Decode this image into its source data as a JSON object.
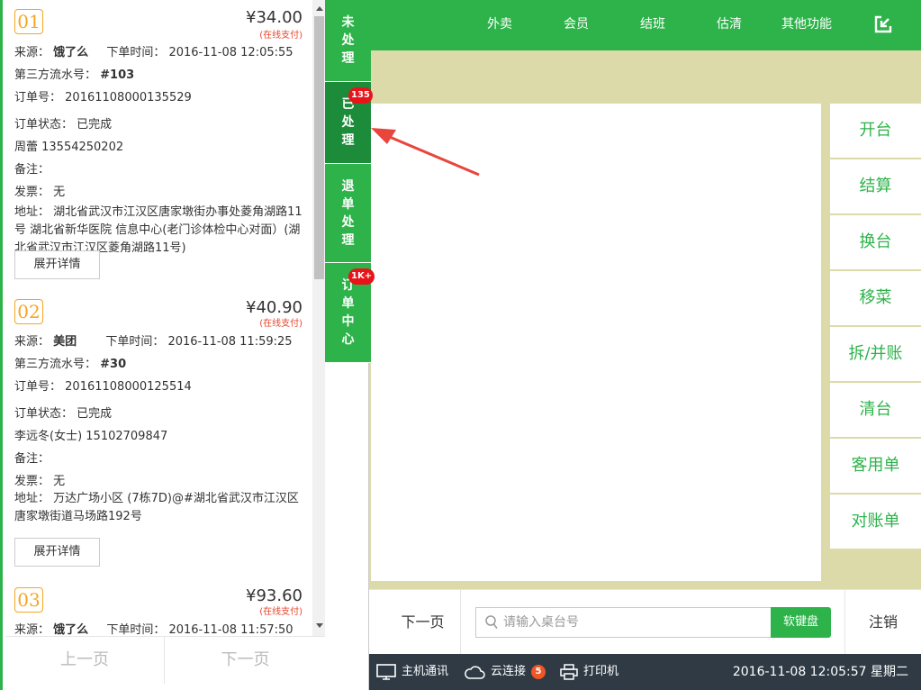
{
  "topnav": [
    "外卖",
    "会员",
    "结班",
    "估清",
    "其他功能"
  ],
  "func_buttons": [
    "开台",
    "结算",
    "换台",
    "移菜",
    "拆/并账",
    "清台",
    "客用单",
    "对账单"
  ],
  "bottombar": {
    "next_page": "下一页",
    "search_placeholder": "请输入桌台号",
    "keyboard": "软键盘",
    "logout": "注销"
  },
  "statusbar": {
    "host": "主机通讯",
    "cloud": "云连接",
    "cloud_count": "5",
    "printer": "打印机",
    "datetime": "2016-11-08 12:05:57 星期二"
  },
  "tabs": [
    {
      "label": [
        "未",
        "处",
        "理"
      ],
      "badge": ""
    },
    {
      "label": [
        "已",
        "处",
        "理"
      ],
      "badge": "135"
    },
    {
      "label": [
        "退",
        "单",
        "处",
        "理"
      ],
      "badge": ""
    },
    {
      "label": [
        "订",
        "单",
        "中",
        "心"
      ],
      "badge": "1K+"
    }
  ],
  "labels": {
    "source": "来源：",
    "order_time": "下单时间：",
    "serial": "第三方流水号：",
    "order_no": "订单号：",
    "status": "订单状态：",
    "note": "备注：",
    "invoice": "发票：",
    "address": "地址：",
    "expand": "展开详情",
    "paid": "(在线支付)"
  },
  "orders": [
    {
      "num": "01",
      "price": "¥34.00",
      "source": "饿了么",
      "time": "2016-11-08 12:05:55",
      "serial": "#103",
      "order_no": "20161108000135529",
      "status": "已完成",
      "contact": "周蕾 13554250202",
      "note": "",
      "invoice": "无",
      "address": "湖北省武汉市江汉区唐家墩街办事处菱角湖路11号 湖北省新华医院 信息中心(老门诊体检中心对面）(湖北省武汉市江汉区菱角湖路11号)"
    },
    {
      "num": "02",
      "price": "¥40.90",
      "source": "美团",
      "time": "2016-11-08 11:59:25",
      "serial": "#30",
      "order_no": "20161108000125514",
      "status": "已完成",
      "contact": "李远冬(女士) 15102709847",
      "note": "",
      "invoice": "无",
      "address": "万达广场小区 (7栋7D)@#湖北省武汉市江汉区唐家墩街道马场路192号"
    },
    {
      "num": "03",
      "price": "¥93.60",
      "source": "饿了么",
      "time": "2016-11-08 11:57:50"
    }
  ],
  "pager": {
    "prev": "上一页",
    "next": "下一页"
  }
}
